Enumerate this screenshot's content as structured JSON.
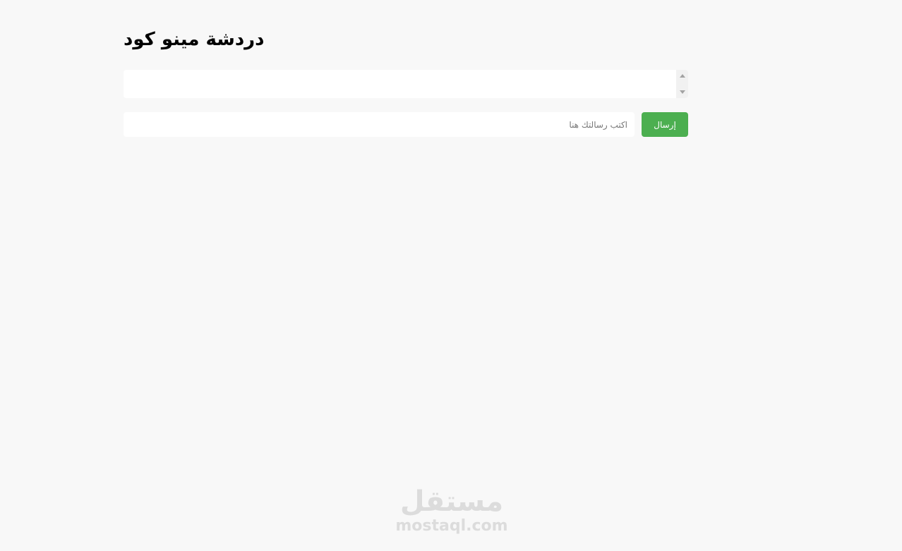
{
  "header": {
    "title": "دردشة مينو كود"
  },
  "chat": {
    "messages": []
  },
  "composer": {
    "placeholder": "اكتب رسالتك هنا",
    "value": "",
    "send_label": "إرسال"
  },
  "colors": {
    "background": "#f8f8f8",
    "send_button": "#4caf50"
  },
  "watermark": {
    "arabic": "مستقل",
    "latin": "mostaql.com"
  }
}
